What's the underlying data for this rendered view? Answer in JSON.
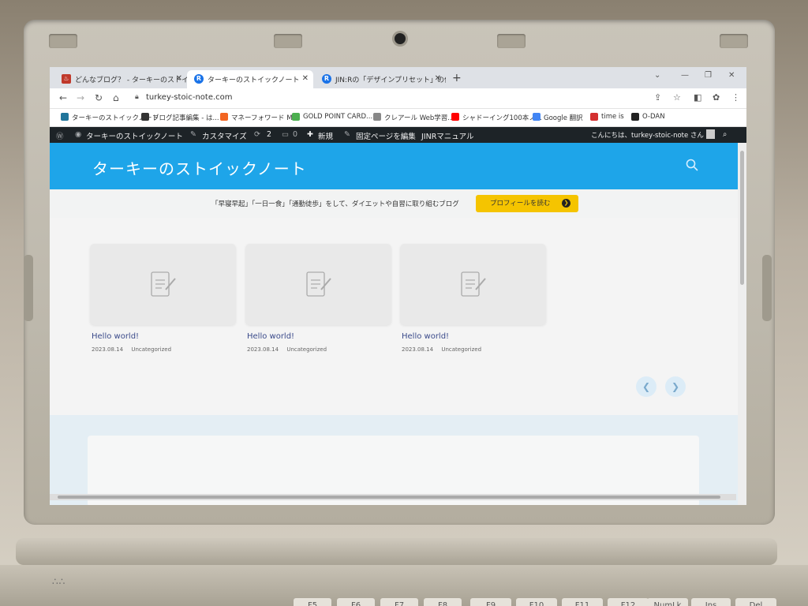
{
  "browser": {
    "tabs": [
      {
        "label": "どんなブログ？ - ターキーのストイックノ",
        "active": false
      },
      {
        "label": "ターキーのストイックノート",
        "active": true
      },
      {
        "label": "JIN:Rの「デザインプリセット」の使い方",
        "active": false
      }
    ],
    "url": "turkey-stoic-note.com",
    "bookmarks": [
      {
        "label": "ターキーのストイックノート",
        "icon_color": "#21759b"
      },
      {
        "label": "ブログ記事編集 - は...",
        "icon_color": "#333333"
      },
      {
        "label": "マネーフォワード ME",
        "icon_color": "#f26522"
      },
      {
        "label": "GOLD POINT CARD...",
        "icon_color": "#4caf50"
      },
      {
        "label": "クレアール Web学習...",
        "icon_color": "#888888"
      },
      {
        "label": "シャドーイング100本ノ...",
        "icon_color": "#ff0000"
      },
      {
        "label": "Google 翻訳",
        "icon_color": "#4285f4"
      },
      {
        "label": "time is",
        "icon_color": "#d32f2f"
      },
      {
        "label": "O-DAN",
        "icon_color": "#222222"
      }
    ]
  },
  "adminbar": {
    "site_name": "ターキーのストイックノート",
    "customize": "カスタマイズ",
    "updates": "2",
    "comments": "0",
    "new": "新規",
    "edit_page": "固定ページを編集",
    "manual": "JINRマニュアル",
    "greeting": "こんにちは、turkey-stoic-note さん"
  },
  "site": {
    "title": "ターキーのストイックノート",
    "notice_text": "「早寝早起」「一日一食」「通勤徒歩」をして、ダイエットや自習に取り組むブログ",
    "profile_button": "プロフィールを読む"
  },
  "posts": [
    {
      "title": "Hello world!",
      "date": "2023.08.14",
      "category": "Uncategorized"
    },
    {
      "title": "Hello world!",
      "date": "2023.08.14",
      "category": "Uncategorized"
    },
    {
      "title": "Hello world!",
      "date": "2023.08.14",
      "category": "Uncategorized"
    }
  ],
  "colors": {
    "header": "#1ea5e9",
    "profile_button": "#f5c400",
    "adminbar": "#1d2327"
  },
  "keyboard_keys": [
    "F5",
    "F6",
    "F7",
    "F8",
    "F9",
    "F10",
    "F11",
    "F12",
    "NumLk",
    "Ins",
    "Del"
  ]
}
